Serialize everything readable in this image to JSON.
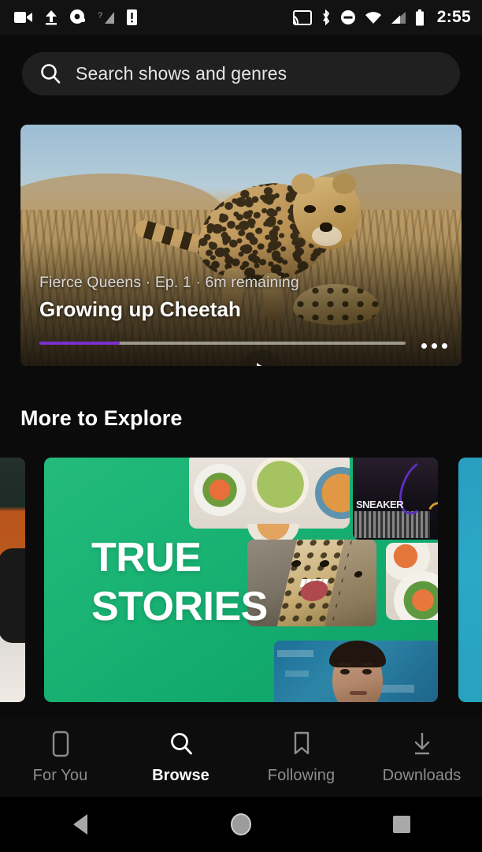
{
  "status_bar": {
    "time": "2:55",
    "left_icons": [
      "video-camera-icon",
      "upload-icon",
      "circle-app-icon",
      "signal-unknown-icon",
      "device-alert-icon"
    ],
    "right_icons": [
      "cast-icon",
      "bluetooth-icon",
      "do-not-disturb-icon",
      "wifi-icon",
      "cellular-signal-icon",
      "battery-icon"
    ]
  },
  "search": {
    "placeholder": "Search shows and genres",
    "value": "",
    "icon": "search-icon"
  },
  "hero": {
    "subtitle": "Fierce Queens · Ep. 1 · 6m remaining",
    "title": "Growing up Cheetah",
    "progress_percent": 22,
    "progress_color": "#7a2fd1",
    "play_icon": "play-icon",
    "overflow_icon": "more-options-icon"
  },
  "section": {
    "title": "More to Explore"
  },
  "carousel": {
    "featured_card": {
      "title_line_1": "TRUE",
      "title_line_2": "STORIES",
      "background_color": "#17b172",
      "tile_labels": {
        "sneaker": "SNEAKER"
      }
    },
    "peek_left_color": "#b9551c",
    "peek_right_color": "#2aa8c6"
  },
  "bottom_nav": {
    "items": [
      {
        "label": "For You",
        "icon": "phone-outline-icon",
        "active": false
      },
      {
        "label": "Browse",
        "icon": "search-icon",
        "active": true
      },
      {
        "label": "Following",
        "icon": "bookmark-icon",
        "active": false
      },
      {
        "label": "Downloads",
        "icon": "download-icon",
        "active": false
      }
    ],
    "active_color": "#ffffff",
    "inactive_color": "#8d8d8d"
  },
  "system_nav": {
    "back": "back-icon",
    "home": "home-icon",
    "recents": "recents-icon"
  }
}
